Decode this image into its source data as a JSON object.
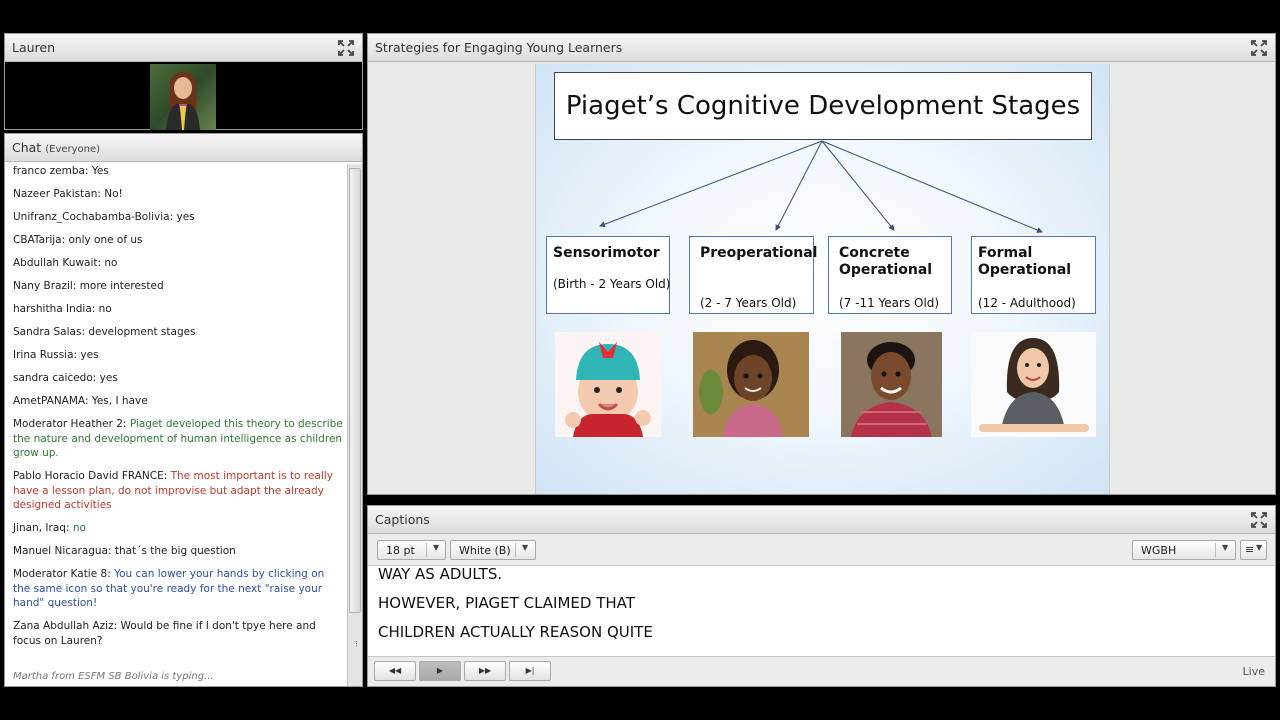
{
  "camera": {
    "title": "Lauren"
  },
  "chat": {
    "title": "Chat",
    "audience": "(Everyone)",
    "messages": [
      {
        "name": "franco zemba",
        "text": "Yes",
        "color": "#222222"
      },
      {
        "name": "Nazeer Pakistan",
        "text": "No!",
        "color": "#222222"
      },
      {
        "name": "Unifranz_Cochabamba-Bolivia",
        "text": "yes",
        "color": "#222222"
      },
      {
        "name": "CBATarija",
        "text": "only one of us",
        "color": "#222222"
      },
      {
        "name": "Abdullah Kuwait",
        "text": "no",
        "color": "#222222"
      },
      {
        "name": "Nany Brazil",
        "text": "more interested",
        "color": "#222222"
      },
      {
        "name": "harshitha India",
        "text": "no",
        "color": "#222222"
      },
      {
        "name": "Sandra Salas",
        "text": "development stages",
        "color": "#222222"
      },
      {
        "name": "Irina Russia",
        "text": "yes",
        "color": "#222222"
      },
      {
        "name": "sandra caicedo",
        "text": "yes",
        "color": "#222222"
      },
      {
        "name": "AmetPANAMA",
        "text": "Yes, I have",
        "color": "#222222"
      },
      {
        "name": "Moderator Heather 2",
        "text": "Piaget developed this theory to describe the nature and development of human intelligence as children grow up.",
        "color": "#2f7a2f"
      },
      {
        "name": "Pablo Horacio David FRANCE",
        "text": "The most important is to really have a lesson plan, do not improvise but adapt the already designed activities",
        "color": "#c0392b"
      },
      {
        "name": "Jinan, Iraq",
        "text": "no",
        "color": "#2f7a2f"
      },
      {
        "name": "Manuel Nicaragua",
        "text": "that´s the big question",
        "color": "#222222"
      },
      {
        "name": "Moderator Katie 8",
        "text": "You can lower your hands by clicking on the same icon so that you're ready for the next \"raise your hand\" question!",
        "color": "#2a4fa8"
      },
      {
        "name": "Zana Abdullah Aziz",
        "text": "Would be fine if  I don't tpye here and focus on Lauren?",
        "color": "#222222"
      }
    ],
    "typing_status": "Martha from ESFM SB Bolivia is typing..."
  },
  "share": {
    "title": "Strategies for Engaging Young Learners",
    "slide_title": "Piaget’s Cognitive Development Stages",
    "stages": [
      {
        "name": "Sensorimotor",
        "age": "(Birth - 2 Years Old)"
      },
      {
        "name": "Preoperational",
        "age": "(2 - 7 Years Old)"
      },
      {
        "name": "Concrete Operational",
        "age": "(7 -11 Years Old)"
      },
      {
        "name": "Formal Operational",
        "age": "(12 - Adulthood)"
      }
    ]
  },
  "captions": {
    "title": "Captions",
    "font_size": "18 pt",
    "color_option": "White (B)",
    "provider": "WGBH",
    "lines": [
      "WAY AS ADULTS.",
      "HOWEVER, PIAGET CLAIMED THAT",
      "CHILDREN ACTUALLY REASON QUITE"
    ],
    "status": "Live"
  }
}
